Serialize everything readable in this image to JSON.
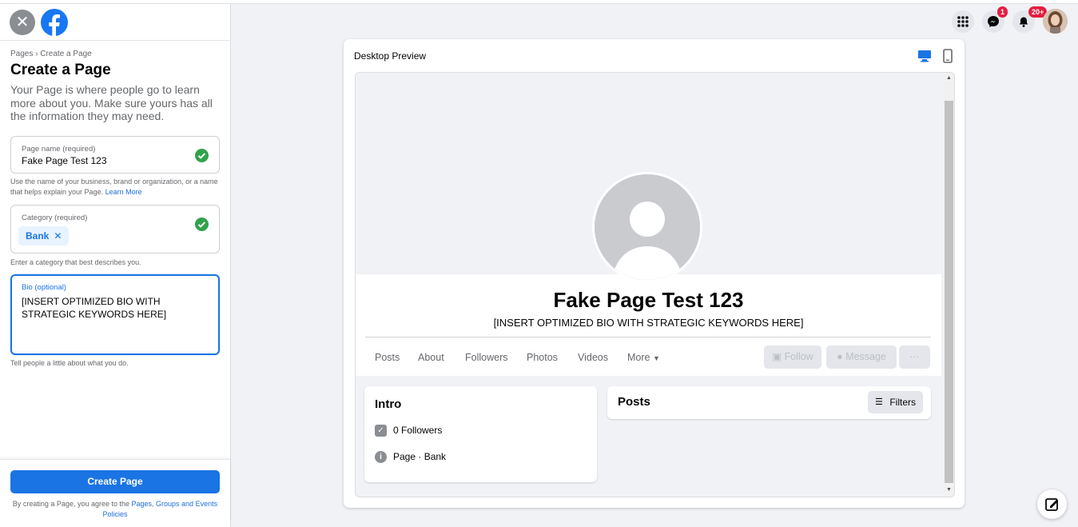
{
  "sidebar": {
    "breadcrumb": "Pages › Create a Page",
    "title": "Create a Page",
    "description": "Your Page is where people go to learn more about you. Make sure yours has all the information they may need.",
    "page_name": {
      "label": "Page name (required)",
      "value": "Fake Page Test 123",
      "help": "Use the name of your business, brand or organization, or a name that helps explain your Page.",
      "help_link": "Learn More"
    },
    "category": {
      "label": "Category (required)",
      "chip": "Bank",
      "chip_remove": "✕",
      "help": "Enter a category that best describes you."
    },
    "bio": {
      "label": "Bio (optional)",
      "value": "[INSERT OPTIMIZED BIO WITH STRATEGIC KEYWORDS HERE]",
      "help": "Tell people a little about what you do."
    },
    "create_button": "Create Page",
    "agreement_text": "By creating a Page, you agree to the",
    "agreement_link": "Pages, Groups and Events Policies"
  },
  "topbar": {
    "messenger_badge": "1",
    "notifications_badge": "20+"
  },
  "preview": {
    "title": "Desktop Preview",
    "page_name": "Fake Page Test 123",
    "bio": "[INSERT OPTIMIZED BIO WITH STRATEGIC KEYWORDS HERE]",
    "tabs": [
      "Posts",
      "About",
      "Followers",
      "Photos",
      "Videos",
      "More"
    ],
    "actions": {
      "follow": "Follow",
      "message": "Message",
      "more": "···"
    },
    "intro": {
      "title": "Intro",
      "followers": "0 Followers",
      "category": "Page · Bank"
    },
    "posts": {
      "title": "Posts",
      "filters": "Filters"
    }
  },
  "colors": {
    "accent": "#1b74e4",
    "success": "#31a24c",
    "badge": "#e41e3f"
  }
}
